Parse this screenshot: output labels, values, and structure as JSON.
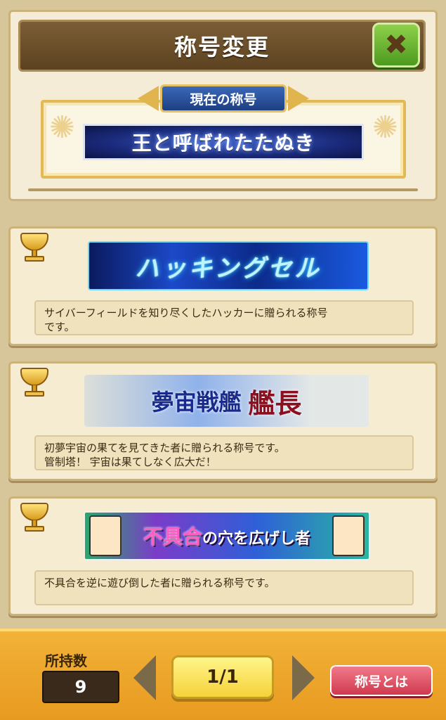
{
  "header": {
    "title": "称号変更",
    "close_icon": "close-x-icon"
  },
  "current": {
    "ribbon_label": "現在の称号",
    "title": "王と呼ばれたたぬき"
  },
  "titles": [
    {
      "banner_text": "ハッキングセル",
      "description": [
        "サイバーフィールドを知り尽くしたハッカーに贈られる称号",
        "です。"
      ]
    },
    {
      "banner_text": "夢宙戦艦",
      "banner_text_2": "艦長",
      "description": [
        "初夢宇宙の果てを見てきた者に贈られる称号です。",
        "管制塔！ 宇宙は果てしなく広大だ！"
      ]
    },
    {
      "banner_text": "不具合",
      "banner_text_2": "の穴を広げし者",
      "description": [
        "不具合を逆に遊び倒した者に贈られる称号です。"
      ]
    }
  ],
  "footer": {
    "count_label": "所持数",
    "count_value": "9",
    "page": "1/1",
    "about_button": "称号とは"
  }
}
